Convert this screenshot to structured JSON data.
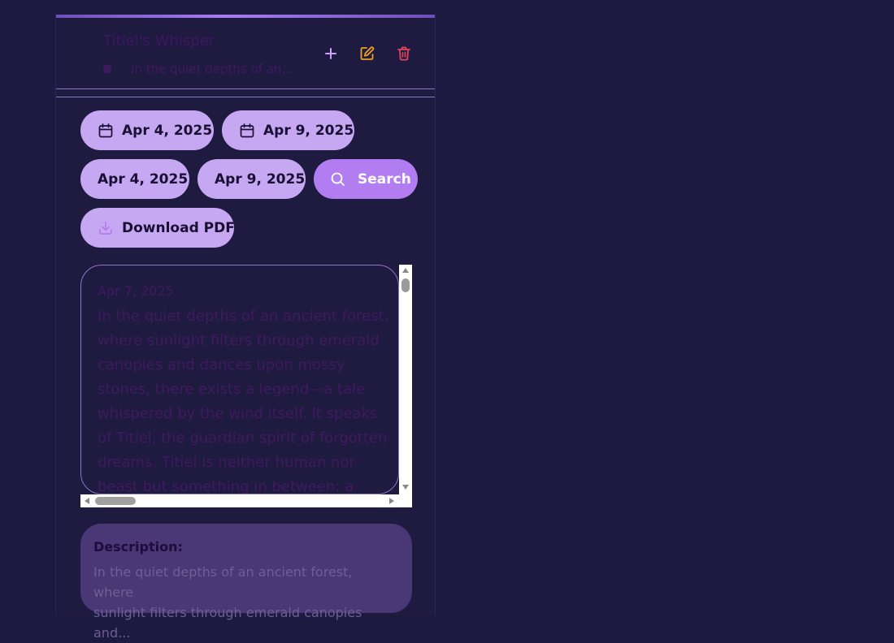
{
  "header": {
    "title": "Titiel's Whisper",
    "preview": "In the quiet depths of an..."
  },
  "filters": {
    "start_date": "Apr 4, 2025",
    "end_date": "Apr 9, 2025",
    "start_date_plain": "Apr 4, 2025",
    "end_date_plain": "Apr 9, 2025",
    "search_label": "Search",
    "download_label": "Download PDF"
  },
  "entry": {
    "date": "Apr 7, 2025",
    "text_lines": [
      "In the quiet depths of an ancient forest,",
      "where sunlight filters through emerald",
      "canopies and dances upon mossy",
      "stones, there exists a legend—a tale",
      "whispered by the wind itself. It speaks",
      "of Titiel, the guardian spirit of forgotten",
      "dreams. Titiel is neither human nor",
      "beast but something in between: a"
    ]
  },
  "description": {
    "label": "Description:",
    "lines": [
      "In the quiet depths of an ancient forest, where",
      "sunlight filters through emerald canopies and..."
    ]
  },
  "icons": {
    "add": "plus-icon",
    "edit": "edit-icon",
    "delete": "trash-icon",
    "calendar": "calendar-icon",
    "search": "search-icon",
    "download": "download-icon"
  },
  "colors": {
    "background": "#1c1a40",
    "pill": "#c6a8f2",
    "search_pill": "#b27df0",
    "add_icon": "#c9a3f5",
    "edit_icon": "#f0a020",
    "delete_icon": "#e0455a"
  }
}
